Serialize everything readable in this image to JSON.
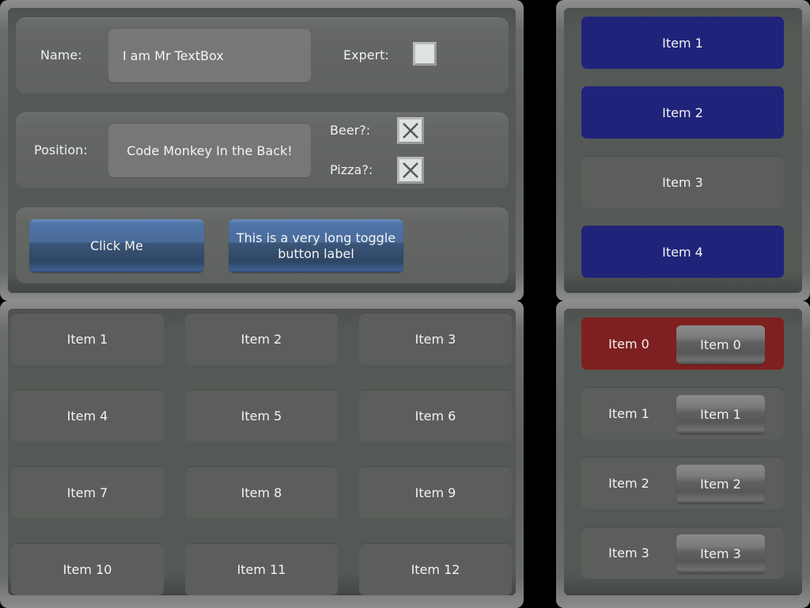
{
  "form": {
    "name_label": "Name:",
    "name_value": "I am Mr TextBox",
    "expert_label": "Expert:",
    "expert_checked": false,
    "position_label": "Position:",
    "position_value": "Code Monkey In the Back!",
    "beer_label": "Beer?:",
    "beer_checked": true,
    "pizza_label": "Pizza?:",
    "pizza_checked": true,
    "click_button": "Click Me",
    "toggle_button": "This is a very long toggle button label"
  },
  "grid": {
    "items": [
      "Item 1",
      "Item 2",
      "Item 3",
      "Item 4",
      "Item 5",
      "Item 6",
      "Item 7",
      "Item 8",
      "Item 9",
      "Item 10",
      "Item 11",
      "Item 12"
    ]
  },
  "list": {
    "items": [
      {
        "label": "Item 1",
        "selected": true
      },
      {
        "label": "Item 2",
        "selected": true
      },
      {
        "label": "Item 3",
        "selected": false
      },
      {
        "label": "Item 4",
        "selected": true
      }
    ]
  },
  "rows": {
    "items": [
      {
        "label": "Item 0",
        "button": "Item 0",
        "selected": true
      },
      {
        "label": "Item 1",
        "button": "Item 1",
        "selected": false
      },
      {
        "label": "Item 2",
        "button": "Item 2",
        "selected": false
      },
      {
        "label": "Item 3",
        "button": "Item 3",
        "selected": false
      }
    ]
  },
  "colors": {
    "selected_blue": "#20237a",
    "selected_red": "#7f2020",
    "button_blue": "#4a6c9c"
  }
}
